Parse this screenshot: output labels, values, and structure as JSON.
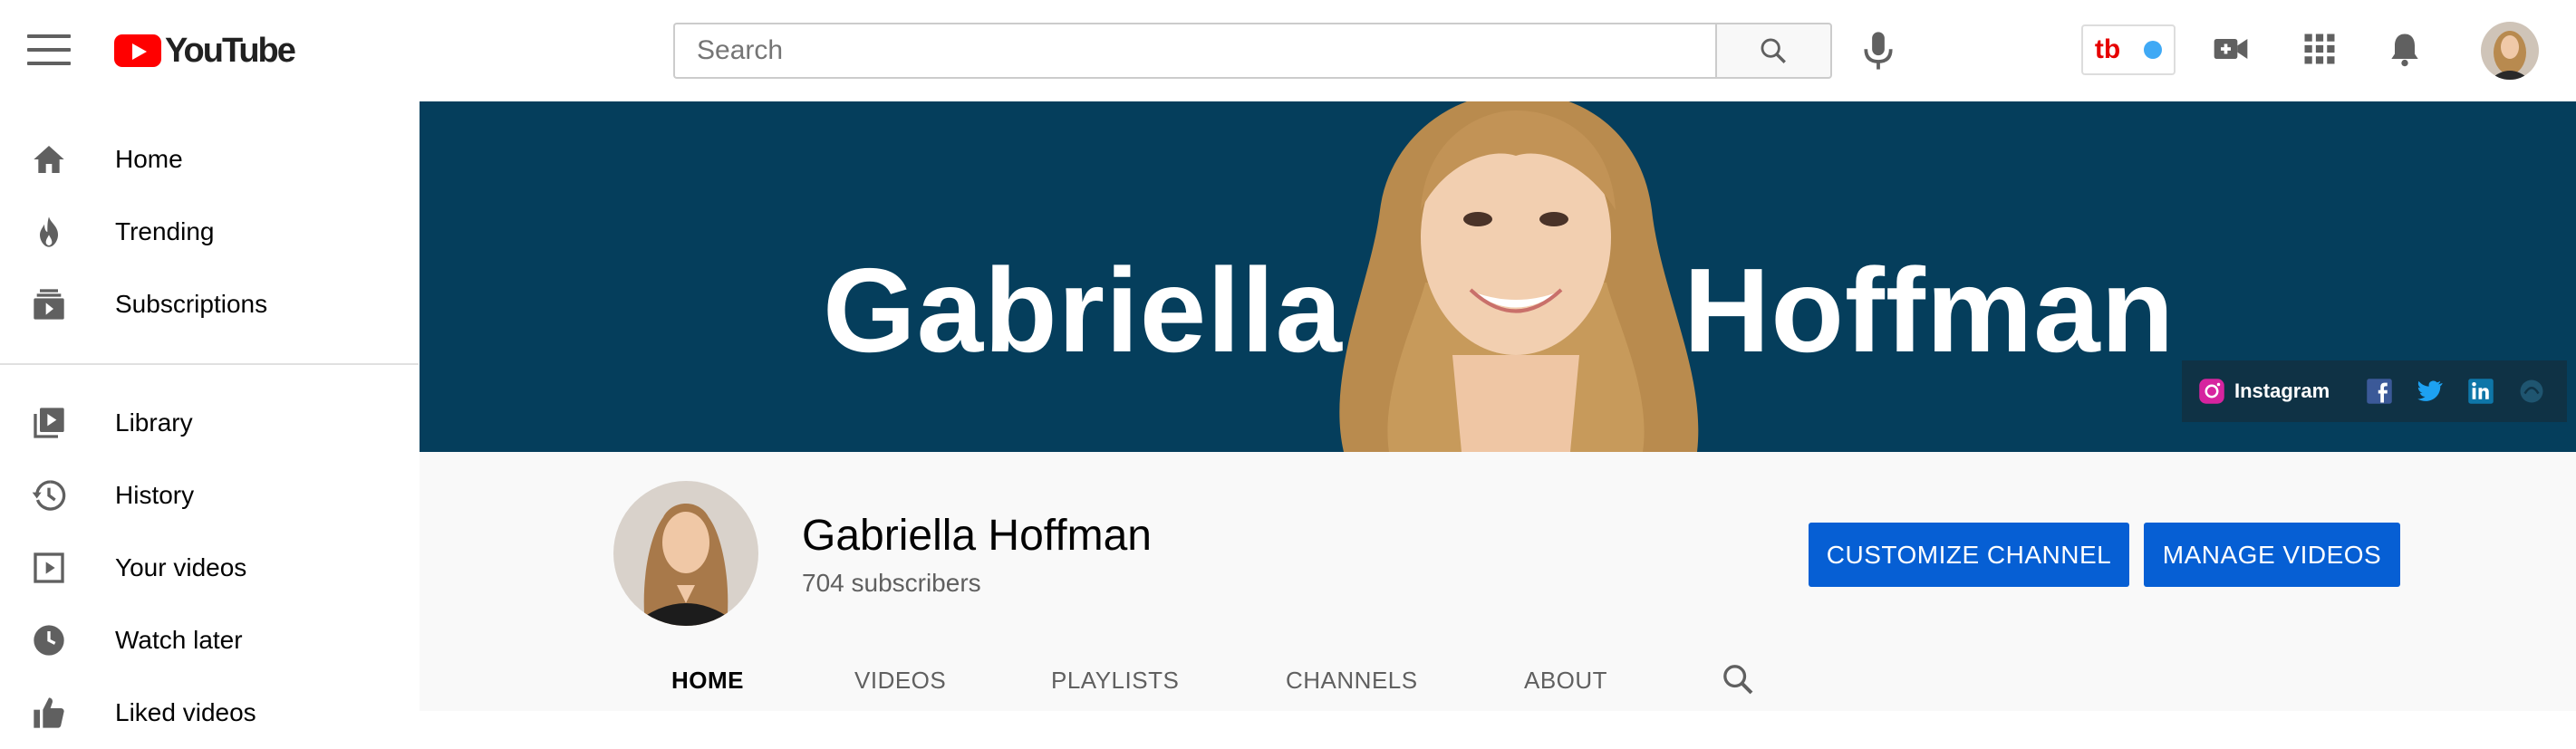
{
  "header": {
    "logo_text": "YouTube",
    "search_placeholder": "Search",
    "extension_label": "tb"
  },
  "sidebar": {
    "items": [
      {
        "label": "Home"
      },
      {
        "label": "Trending"
      },
      {
        "label": "Subscriptions"
      },
      {
        "label": "Library"
      },
      {
        "label": "History"
      },
      {
        "label": "Your videos"
      },
      {
        "label": "Watch later"
      },
      {
        "label": "Liked videos"
      }
    ]
  },
  "banner": {
    "first_name": "Gabriella",
    "last_name": "Hoffman",
    "background_color": "#053e5c",
    "social_label": "Instagram"
  },
  "channel": {
    "name": "Gabriella Hoffman",
    "subscribers": "704 subscribers",
    "customize_label": "CUSTOMIZE CHANNEL",
    "manage_label": "MANAGE VIDEOS",
    "accent_color": "#065fd4"
  },
  "tabs": [
    {
      "label": "HOME",
      "active": true
    },
    {
      "label": "VIDEOS",
      "active": false
    },
    {
      "label": "PLAYLISTS",
      "active": false
    },
    {
      "label": "CHANNELS",
      "active": false
    },
    {
      "label": "ABOUT",
      "active": false
    }
  ]
}
